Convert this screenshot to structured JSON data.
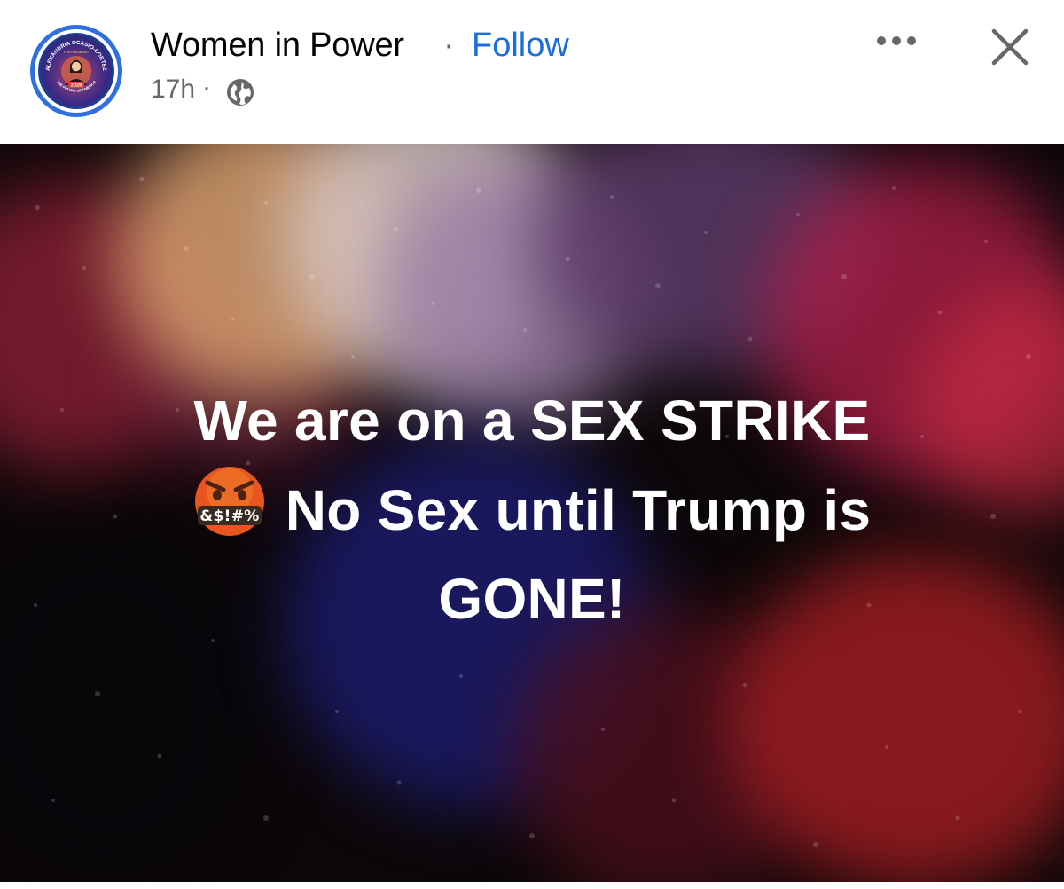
{
  "header": {
    "page_name": "Women in Power",
    "separator": "·",
    "follow_label": "Follow",
    "timestamp": "17h",
    "meta_separator": "·",
    "audience_icon": "globe-icon",
    "more_icon": "more-horizontal-icon",
    "close_icon": "close-icon"
  },
  "avatar": {
    "ring_text_top": "ALEXANDRIA OCASIO-CORTEZ",
    "ring_text_sub": "FOR PRESIDENT",
    "badge_year": "2028",
    "ring_text_bottom": "THE FUTURE OF AMERICA",
    "ring_color": "#2f6fe0"
  },
  "post": {
    "line1": "We are on a SEX STRIKE",
    "line2": "No Sex until Trump is",
    "line3": "GONE!",
    "emoji": "face-with-symbols-on-mouth-icon",
    "emoji_symbols": "&$!#%"
  },
  "colors": {
    "follow": "#1b6fd9",
    "name": "#050505",
    "meta": "#65676b",
    "post_text": "#ffffff"
  }
}
